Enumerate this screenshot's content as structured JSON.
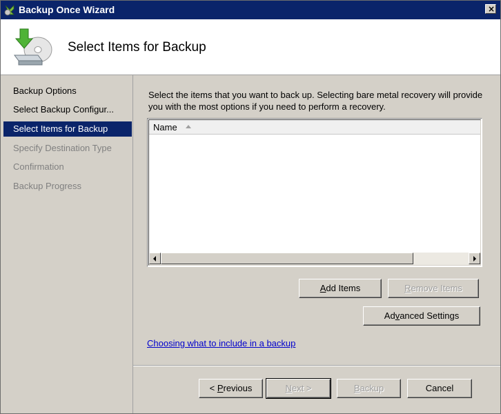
{
  "window": {
    "title": "Backup Once Wizard",
    "close_label": "×"
  },
  "header": {
    "page_title": "Select Items for Backup"
  },
  "steps": [
    {
      "label": "Backup Options",
      "state": "done"
    },
    {
      "label": "Select Backup Configur...",
      "state": "done"
    },
    {
      "label": "Select Items for Backup",
      "state": "current"
    },
    {
      "label": "Specify Destination Type",
      "state": "pending"
    },
    {
      "label": "Confirmation",
      "state": "pending"
    },
    {
      "label": "Backup Progress",
      "state": "pending"
    }
  ],
  "main": {
    "description": "Select the items that you want to back up. Selecting bare metal recovery will provide you with the most options if you need to perform a recovery.",
    "list": {
      "column_name": "Name",
      "items": []
    },
    "add_items": {
      "mnemonic": "A",
      "rest": "dd Items"
    },
    "remove_items": {
      "mnemonic": "R",
      "rest": "emove Items"
    },
    "advanced_settings": {
      "before": "Ad",
      "mnemonic": "v",
      "after": "anced Settings"
    },
    "help_link": "Choosing what to include in a backup"
  },
  "footer": {
    "previous": {
      "before": "< ",
      "mnemonic": "P",
      "after": "revious"
    },
    "next": {
      "mnemonic": "N",
      "after": "ext >"
    },
    "backup": {
      "mnemonic": "B",
      "after": "ackup"
    },
    "cancel": "Cancel"
  },
  "colors": {
    "titlebar": "#0a246a",
    "selection": "#0a246a",
    "face": "#d4d0c8",
    "link": "#0000cc"
  }
}
